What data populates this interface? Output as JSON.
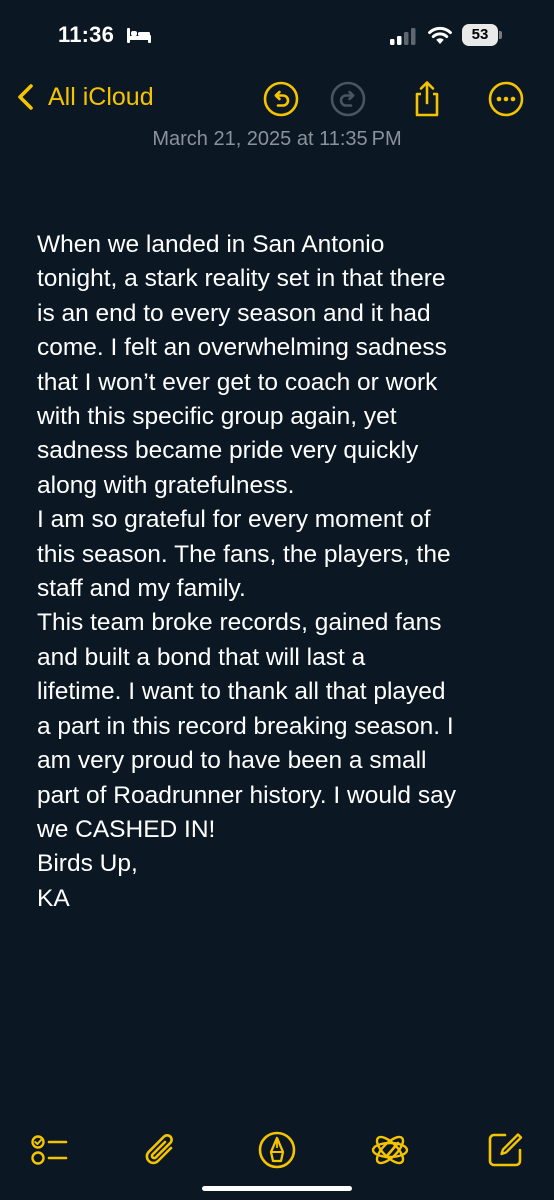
{
  "status_bar": {
    "time": "11:36",
    "battery_level": "53",
    "icons": [
      "bed-icon",
      "cellular-signal-icon",
      "wifi-icon",
      "battery-icon"
    ]
  },
  "nav": {
    "back_label": "All iCloud",
    "buttons": [
      "undo-icon",
      "redo-icon",
      "share-icon",
      "more-icon"
    ],
    "accent_color": "#f5c400"
  },
  "note": {
    "timestamp": "March 21, 2025 at 11:35 PM",
    "lines": [
      "When we landed in San Antonio",
      "tonight, a stark reality set in that there",
      "is an end to every season and it had",
      "come. I felt an overwhelming sadness",
      "that I won’t ever get to coach or work",
      "with this specific group again, yet",
      "sadness became  pride very quickly",
      "along with gratefulness.",
      "I am so grateful for every moment of",
      "this season.  The fans, the players, the",
      "staff and my family.",
      "This team broke records, gained fans",
      "and built a bond that will last a",
      "lifetime.  I want to thank all that played",
      "a part in this record breaking season. I",
      "am very proud to have been a small",
      "part of Roadrunner history. I would say",
      "we CASHED IN!",
      "Birds Up,",
      "KA"
    ]
  },
  "toolbar": {
    "buttons": [
      "checklist-icon",
      "paperclip-icon",
      "markup-pen-icon",
      "apple-intelligence-icon",
      "compose-icon"
    ]
  },
  "colors": {
    "background": "#0b1722",
    "accent": "#f5c400",
    "timestamp": "#8a929c",
    "text": "#ffffff"
  }
}
